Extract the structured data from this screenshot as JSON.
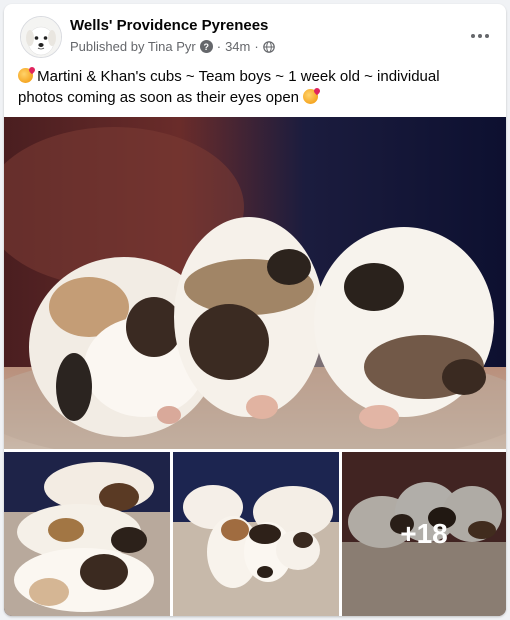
{
  "post": {
    "page_name": "Wells' Providence Pyrenees",
    "published_by": "Published by Tina Pyr",
    "timestamp": "34m",
    "caption": "Martini & Khan's cubs ~ Team boys ~ 1 week old ~ individual photos coming as soon as their eyes open",
    "more_photos_count": "+18"
  },
  "icons": {
    "avatar": "dog-avatar",
    "info": "question-circle-icon",
    "audience": "globe-icon",
    "more": "more-options-icon",
    "emoji": "smiling-face-with-hearts-icon"
  },
  "colors": {
    "text_primary": "#050505",
    "text_secondary": "#65676b",
    "background": "#f0f2f5",
    "card": "#ffffff"
  }
}
